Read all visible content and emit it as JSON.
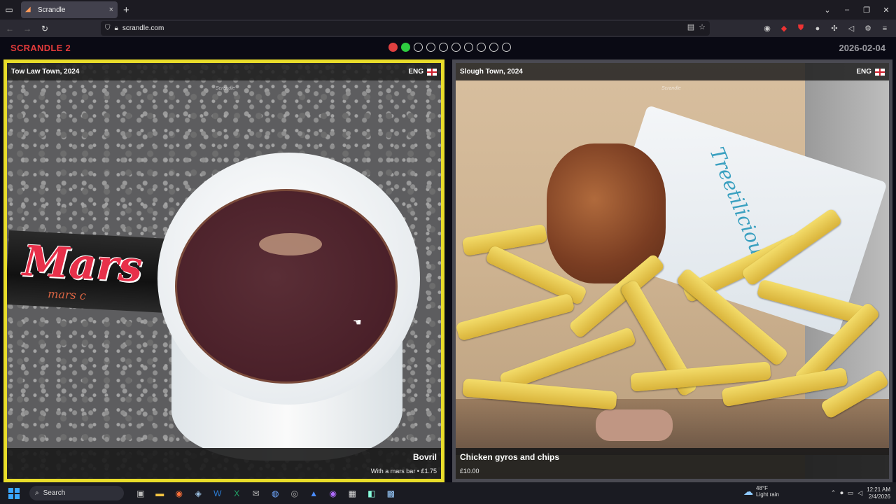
{
  "browser": {
    "tab_title": "Scrandle",
    "url": "scrandle.com",
    "new_tab_symbol": "+",
    "tab_close_symbol": "×"
  },
  "page": {
    "brand": "SCRANDLE 2",
    "date": "2026-02-04",
    "progress": {
      "total": 10,
      "completed": 2,
      "results": [
        "wrong",
        "correct"
      ]
    }
  },
  "left_card": {
    "location": "Tow Law Town, 2024",
    "country": "ENG",
    "watermark": "Scrandle",
    "title": "Bovril",
    "subtitle": "With a mars bar • £1.75",
    "selected": true,
    "image_text": {
      "brand": "Mars",
      "small": "mars c"
    }
  },
  "right_card": {
    "location": "Slough Town, 2024",
    "country": "ENG",
    "watermark": "Scrandle",
    "title": "Chicken gyros and chips",
    "subtitle": "£10.00",
    "selected": false,
    "image_text": {
      "wrap": "Treetilicious"
    }
  },
  "taskbar": {
    "search_label": "Search",
    "weather_temp": "48°F",
    "weather_desc": "Light rain",
    "time": "12:21 AM",
    "date": "2/4/2026"
  },
  "colors": {
    "brand_red": "#e23a3a",
    "selected_border": "#e8dc2a",
    "unselected_border": "#4a4a52",
    "dot_correct": "#2ecc40",
    "dot_wrong": "#e04040"
  }
}
